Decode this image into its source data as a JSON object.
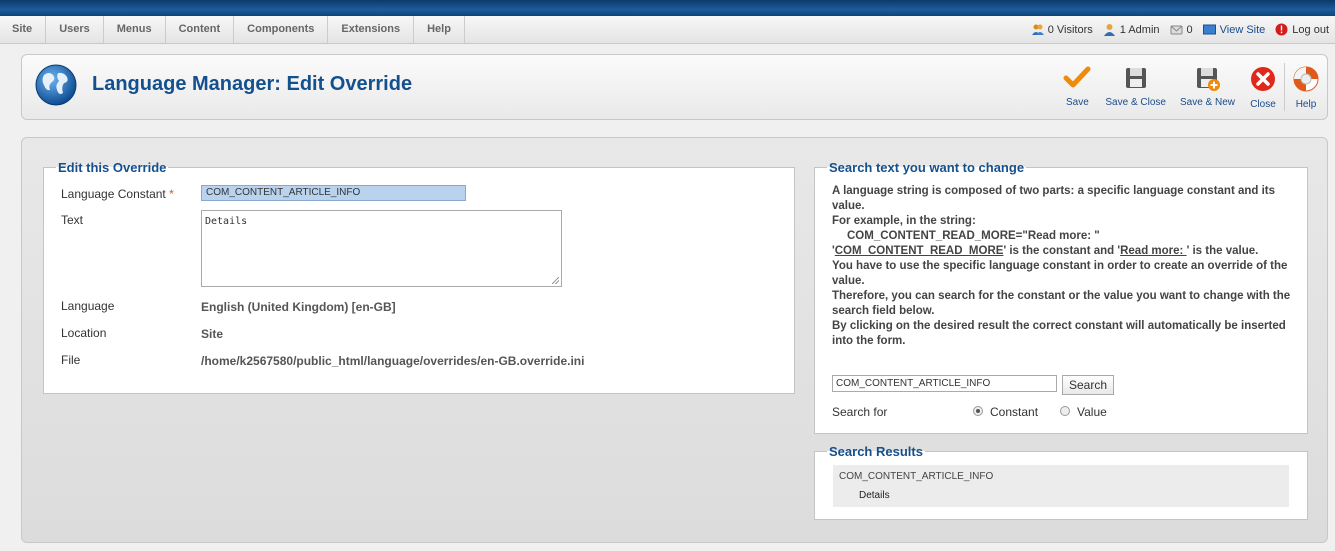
{
  "menu": [
    "Site",
    "Users",
    "Menus",
    "Content",
    "Components",
    "Extensions",
    "Help"
  ],
  "status": {
    "visitors": "0 Visitors",
    "admins": "1 Admin",
    "messages": "0",
    "view_site": "View Site",
    "logout": "Log out"
  },
  "page_title": "Language Manager: Edit Override",
  "toolbar": {
    "save": "Save",
    "save_close": "Save & Close",
    "save_new": "Save & New",
    "close": "Close",
    "help": "Help"
  },
  "edit": {
    "legend": "Edit this Override",
    "constant_label": "Language Constant",
    "required_mark": "*",
    "constant_value": "COM_CONTENT_ARTICLE_INFO",
    "text_label": "Text",
    "text_value": "Details",
    "language_label": "Language",
    "language_value": "English (United Kingdom) [en-GB]",
    "location_label": "Location",
    "location_value": "Site",
    "file_label": "File",
    "file_value": "/home/k2567580/public_html/language/overrides/en-GB.override.ini"
  },
  "search": {
    "legend": "Search text you want to change",
    "help_1": "A language string is composed of two parts: a specific language constant and its value.",
    "help_2": "For example, in the string:",
    "help_3": "COM_CONTENT_READ_MORE=\"Read more: \"",
    "help_4a": "'",
    "help_4b": "COM_CONTENT_READ_MORE",
    "help_4c": "' is the constant and '",
    "help_4d": "Read more: ",
    "help_4e": "' is the value.",
    "help_5": "You have to use the specific language constant in order to create an override of the value.",
    "help_6": "Therefore, you can search for the constant or the value you want to change with the search field below.",
    "help_7": "By clicking on the desired result the correct constant will automatically be inserted into the form.",
    "input_value": "COM_CONTENT_ARTICLE_INFO",
    "button": "Search",
    "search_for_label": "Search for",
    "opt_constant": "Constant",
    "opt_value": "Value",
    "selected": "Constant"
  },
  "results": {
    "legend": "Search Results",
    "constant": "COM_CONTENT_ARTICLE_INFO",
    "value": "Details"
  },
  "colors": {
    "accent": "#14508e",
    "topbar": "#0d4478",
    "input_highlight": "#b9d3ef"
  }
}
